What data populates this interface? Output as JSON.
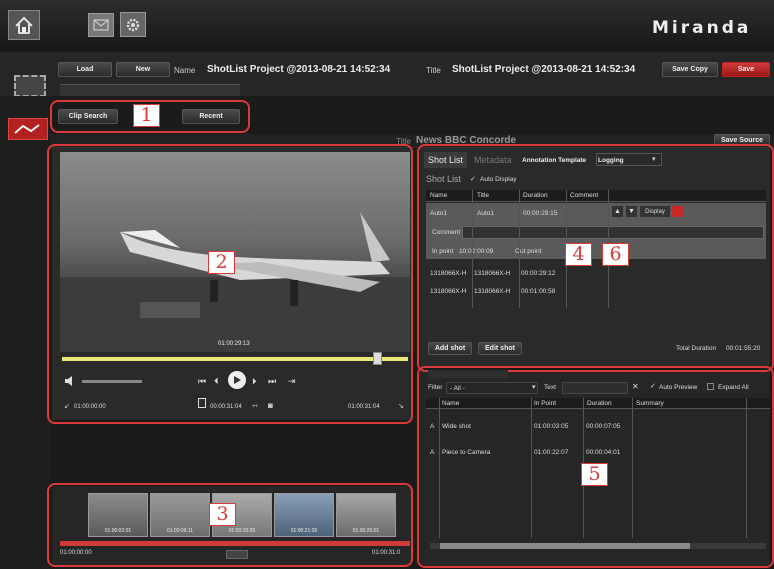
{
  "brand": "Miranda",
  "top_bar": {
    "icons": [
      "home-icon",
      "mail-icon",
      "settings-icon"
    ]
  },
  "project": {
    "load_label": "Load",
    "new_label": "New",
    "name_label": "Name",
    "name_value": "ShotList Project @2013-08-21 14:52:34",
    "title_label": "Title",
    "title_value": "ShotList Project @2013-08-21 14:52:34",
    "save_copy_label": "Save Copy",
    "save_label": "Save"
  },
  "search_tabs": {
    "clip_search": "Clip Search",
    "recent": "Recent"
  },
  "source": {
    "title_label": "Title",
    "title_value": "News BBC Concorde",
    "save_source_label": "Save Source"
  },
  "player": {
    "video_timecode": "01:00:29:13",
    "in_tc": "01:00:00:00",
    "duration_tc": "00:00:31:04",
    "out_tc": "01:00:31:04"
  },
  "filmstrip": {
    "thumbs": [
      "01:00:02:01",
      "01:00:09:11",
      "01:00:15:26",
      "01:00:21:26",
      "01:00:26:01"
    ],
    "start_tc": "01:00:00:00",
    "end_tc": "01:00:31:0"
  },
  "shotlist": {
    "tabs": [
      "Shot List",
      "Metadata",
      "Annotation Template",
      "Logging"
    ],
    "heading": "Shot List",
    "auto_display_label": "Auto Display",
    "columns": [
      "Name",
      "Title",
      "Duration",
      "Comment"
    ],
    "selected_row": {
      "name": "Auto1",
      "title": "Auto1",
      "duration": "00:00:29:15"
    },
    "display_label": "Display",
    "comment_label": "Comment",
    "in_point_label": "In point",
    "in_point_value": "10:02:00:09",
    "out_point_label": "Out point",
    "rows": [
      {
        "name": "1318066X-H",
        "title": "1318066X-H",
        "duration": "00:00:29:12"
      },
      {
        "name": "1318066X-H",
        "title": "1318066X-H",
        "duration": "00:01:00:58"
      }
    ],
    "add_shot_label": "Add shot",
    "edit_shot_label": "Edit shot",
    "total_duration_label": "Total Duration",
    "total_duration_value": "00:01:55:20"
  },
  "notes": {
    "filter_label": "Filter",
    "filter_value": "- All -",
    "text_label": "Text",
    "auto_preview_label": "Auto Preview",
    "expand_all_label": "Expand All",
    "columns": [
      "Name",
      "In Point",
      "Duration",
      "Summary"
    ],
    "rows": [
      {
        "type": "A",
        "name": "Wide shot",
        "in": "01:00:03:05",
        "duration": "00:00:07:05"
      },
      {
        "type": "A",
        "name": "Piece to Camera",
        "in": "01:00:22:07",
        "duration": "00:00:04:01"
      }
    ]
  },
  "callouts": [
    "1",
    "2",
    "3",
    "4",
    "6",
    "5"
  ],
  "colors": {
    "highlight": "#d93a3a",
    "save_red": "#c62828",
    "accent_yellow": "#e8e87a"
  }
}
